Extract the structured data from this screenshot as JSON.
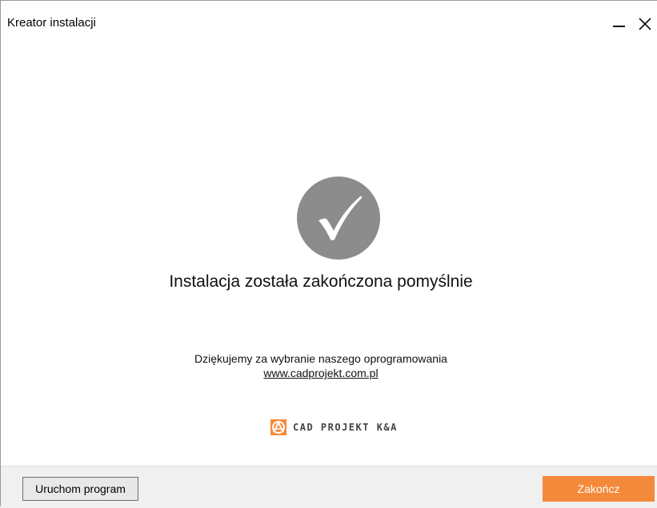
{
  "window": {
    "title": "Kreator instalacji"
  },
  "content": {
    "headline": "Instalacja została zakończona pomyślnie",
    "thanks": "Dziękujemy za wybranie naszego oprogramowania",
    "link": "www.cadprojekt.com.pl",
    "logo_text": "CAD PROJEKT K&A"
  },
  "footer": {
    "run_label": "Uruchom program",
    "finish_label": "Zakończ"
  },
  "colors": {
    "accent": "#f5893a",
    "check_circle": "#8c8c8c"
  },
  "icons": [
    "minimize-icon",
    "close-icon",
    "checkmark-icon",
    "cad-projekt-logo-icon"
  ]
}
